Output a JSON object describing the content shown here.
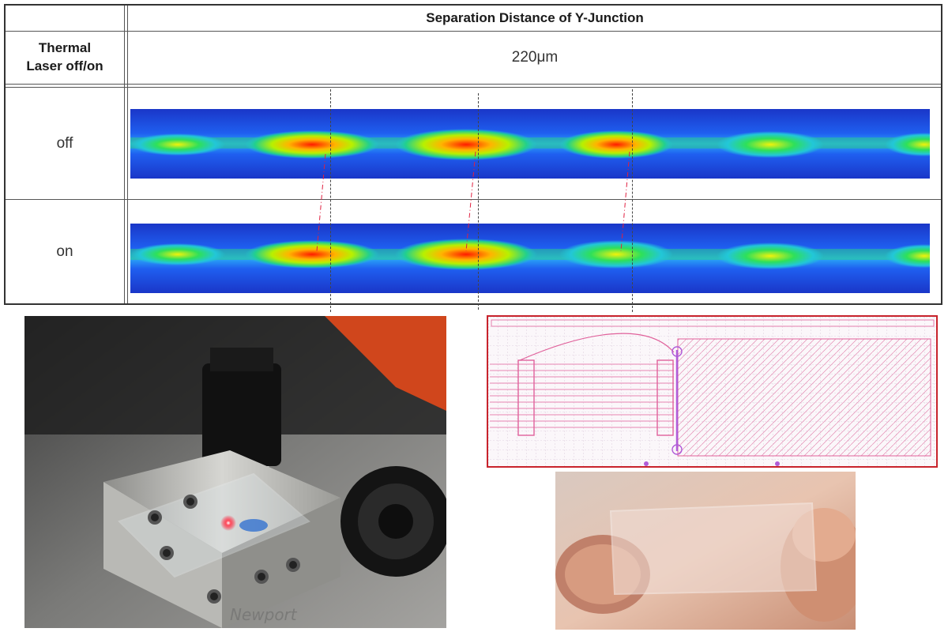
{
  "table": {
    "header_title": "Separation Distance of Y-Junction",
    "col_header": "Thermal Laser off/on",
    "col_header_line1": "Thermal",
    "col_header_line2": "Laser off/on",
    "distance_value": "220μm",
    "rows": [
      {
        "label": "off"
      },
      {
        "label": "on"
      }
    ]
  },
  "colors": {
    "mode_background": "#1c3fd8",
    "mode_core": "#00d2a0",
    "mode_hot": "#ff2a00",
    "layout_border": "#c8232c",
    "layout_lines": "#e0619b",
    "layout_marker": "#b05cd8"
  },
  "images": [
    {
      "name": "laser-setup-photo",
      "depicts": "Newport stage with chip and red laser"
    },
    {
      "name": "mask-layout-drawing",
      "depicts": "Y-junction waveguide mask layout"
    },
    {
      "name": "glass-chip-photo",
      "depicts": "transparent glass chip held in fingers"
    }
  ],
  "stage_brand": "Newport"
}
